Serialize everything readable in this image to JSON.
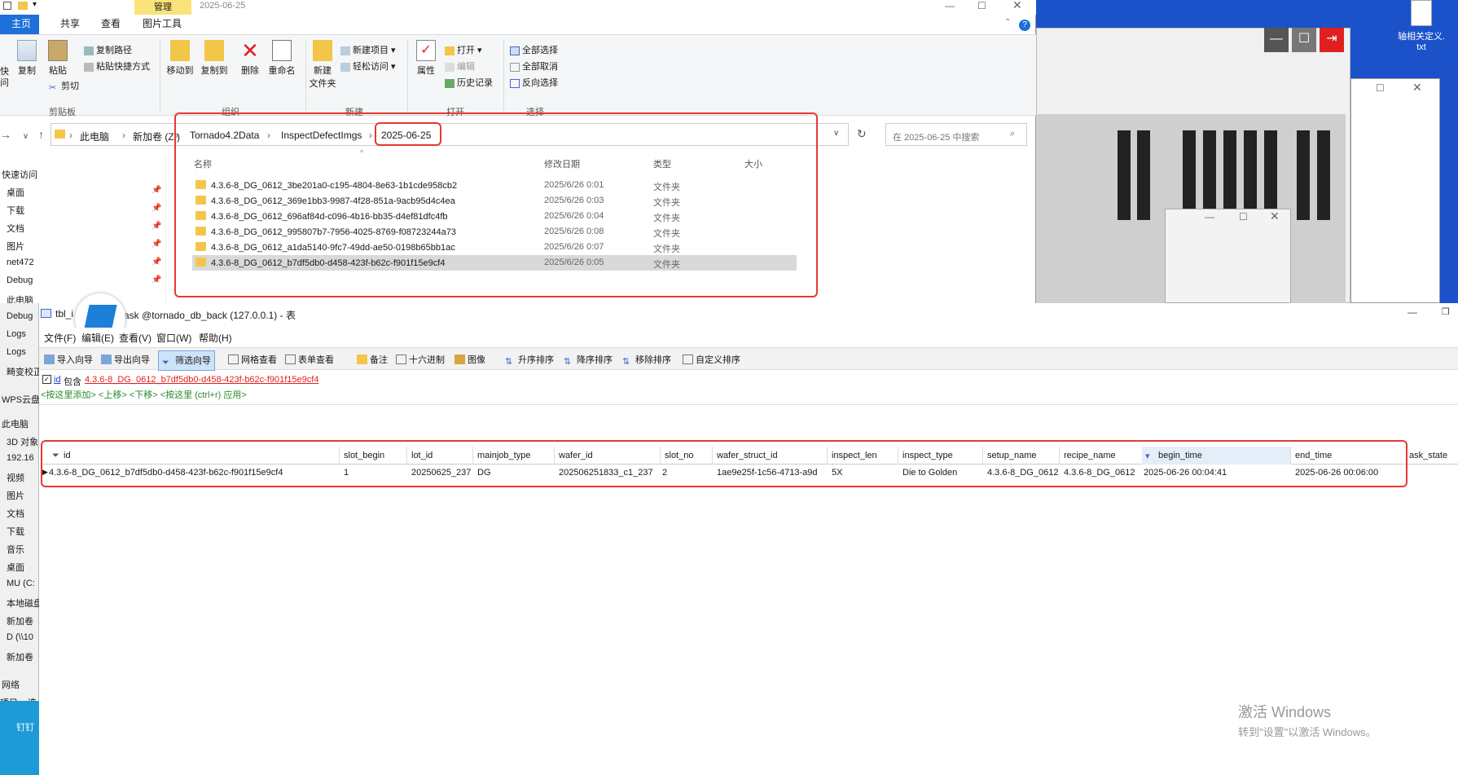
{
  "explorer": {
    "title_date": "2025-06-25",
    "manage_tab": "管理",
    "tabs": [
      "主页",
      "共享",
      "查看",
      "图片工具"
    ],
    "ribbon": {
      "left_cut": [
        "快",
        "问"
      ],
      "copy": "复制",
      "paste": "粘贴",
      "copy_path": "复制路径",
      "paste_shortcut": "粘贴快捷方式",
      "cut": "剪切",
      "move_to": "移动到",
      "copy_to": "复制到",
      "delete": "删除",
      "rename": "重命名",
      "new_folder_l1": "新建",
      "new_folder_l2": "文件夹",
      "new_item": "新建项目",
      "easy_access": "轻松访问",
      "properties": "属性",
      "open": "打开",
      "edit": "编辑",
      "history": "历史记录",
      "select_all": "全部选择",
      "select_none": "全部取消",
      "invert": "反向选择",
      "groups": [
        "剪贴板",
        "组织",
        "新建",
        "打开",
        "选择"
      ]
    },
    "breadcrumb": [
      "此电脑",
      "新加卷 (Z:)",
      "Tornado4.2Data",
      "InspectDefectImgs",
      "2025-06-25"
    ],
    "search_placeholder": "在 2025-06-25 中搜索",
    "columns": [
      "名称",
      "修改日期",
      "类型",
      "大小"
    ],
    "files": [
      {
        "name": "4.3.6-8_DG_0612_3be201a0-c195-4804-8e63-1b1cde958cb2",
        "date": "2025/6/26 0:01",
        "type": "文件夹"
      },
      {
        "name": "4.3.6-8_DG_0612_369e1bb3-9987-4f28-851a-9acb95d4c4ea",
        "date": "2025/6/26 0:03",
        "type": "文件夹"
      },
      {
        "name": "4.3.6-8_DG_0612_696af84d-c096-4b16-bb35-d4ef81dfc4fb",
        "date": "2025/6/26 0:04",
        "type": "文件夹"
      },
      {
        "name": "4.3.6-8_DG_0612_995807b7-7956-4025-8769-f08723244a73",
        "date": "2025/6/26 0:08",
        "type": "文件夹"
      },
      {
        "name": "4.3.6-8_DG_0612_a1da5140-9fc7-49dd-ae50-0198b65bb1ac",
        "date": "2025/6/26 0:07",
        "type": "文件夹"
      },
      {
        "name": "4.3.6-8_DG_0612_b7df5db0-d458-423f-b62c-f901f15e9cf4",
        "date": "2025/6/26 0:05",
        "type": "文件夹"
      }
    ],
    "sidebar": [
      "快速访问",
      "桌面",
      "下载",
      "文档",
      "图片",
      "net472",
      "Debug",
      "此电脑",
      "Debug",
      "Logs",
      "Logs",
      "畸变校正"
    ]
  },
  "desktop": {
    "file_label_l1": "轴相关定义.",
    "file_label_l2": "txt"
  },
  "navicat": {
    "title_left": "tbl_i",
    "title_right": "ask @tornado_db_back (127.0.0.1) - 表",
    "menu": [
      "文件(F)",
      "编辑(E)",
      "查看(V)",
      "窗口(W)",
      "帮助(H)"
    ],
    "toolbar": [
      "导入向导",
      "导出向导",
      "筛选向导",
      "网格查看",
      "表单查看",
      "备注",
      "十六进制",
      "图像",
      "升序排序",
      "降序排序",
      "移除排序",
      "自定义排序"
    ],
    "filter_field": "id",
    "filter_op": "包含",
    "filter_value": "4.3.6-8_DG_0612_b7df5db0-d458-423f-b62c-f901f15e9cf4",
    "filter_hint": "<按这里添加> <上移> <下移> <按这里 (ctrl+r) 应用>",
    "columns": [
      "id",
      "slot_begin",
      "lot_id",
      "mainjob_type",
      "wafer_id",
      "slot_no",
      "wafer_struct_id",
      "inspect_len",
      "inspect_type",
      "setup_name",
      "recipe_name",
      "begin_time",
      "end_time",
      "ask_state"
    ],
    "row": [
      "4.3.6-8_DG_0612_b7df5db0-d458-423f-b62c-f901f15e9cf4",
      "1",
      "20250625_237",
      "DG",
      "202506251833_c1_237",
      "2",
      "1ae9e25f-1c56-4713-a9d",
      "5X",
      "Die to Golden",
      "4.3.6-8_DG_0612",
      "4.3.6-8_DG_0612",
      "2025-06-26 00:04:41",
      "2025-06-26 00:06:00",
      ""
    ]
  },
  "left_strip": [
    "WPS云盘",
    "此电脑",
    "3D 对象",
    "192.16",
    "视频",
    "图片",
    "文档",
    "下载",
    "音乐",
    "桌面",
    "MU (C:",
    "本地磁盘",
    "新加卷",
    "D (\\\\10",
    "新加卷",
    "网络",
    "项目",
    "选",
    "钉钉"
  ],
  "watermark": {
    "line1": "激活 Windows",
    "line2": "转到\"设置\"以激活 Windows。"
  },
  "colors": {
    "accent": "#1e6fd9",
    "highlight_red": "#e53935",
    "manage_yellow": "#f9e27a",
    "desktop_blue": "#1b52c9"
  }
}
